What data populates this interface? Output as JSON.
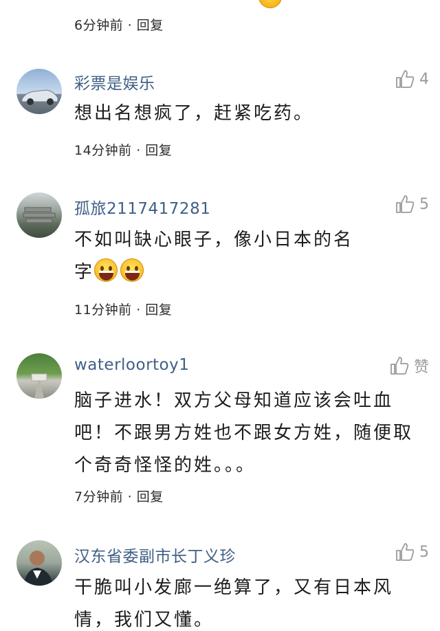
{
  "top": {
    "partial_text": "",
    "meta": "6分钟前 · 回复"
  },
  "comments": [
    {
      "username": "彩票是娱乐",
      "likes": "4",
      "text": "想出名想疯了，赶紧吃药。",
      "meta": "14分钟前 · 回复",
      "avatar_icon": "car-avatar"
    },
    {
      "username": "孤旅2117417281",
      "likes": "5",
      "text_line1": "不如叫缺心眼子，像小日本的名",
      "text_line2": "字",
      "emoji_count": 2,
      "meta": "11分钟前 · 回复",
      "avatar_icon": "landscape-avatar"
    },
    {
      "username": "waterloortoy1",
      "likes": "赞",
      "text_line1": "脑子进水！双方父母知道应该会吐血",
      "text_line2": "吧！不跟男方姓也不跟女方姓，随便取",
      "text_line3": "个奇奇怪怪的姓。。。",
      "meta": "7分钟前 · 回复",
      "avatar_icon": "road-avatar"
    },
    {
      "username": "汉东省委副市长丁义珍",
      "likes": "5",
      "text_line1": "干脆叫小发廊一绝算了，又有日本风",
      "text_line2": "情，我们又懂。",
      "avatar_icon": "person-avatar"
    }
  ],
  "icons": {
    "like": "thumbs-up-icon",
    "emoji": "grinning-face-icon"
  },
  "colors": {
    "username": "#3f5f86",
    "meta": "#2b2b2b",
    "like": "#9a9a9a"
  }
}
